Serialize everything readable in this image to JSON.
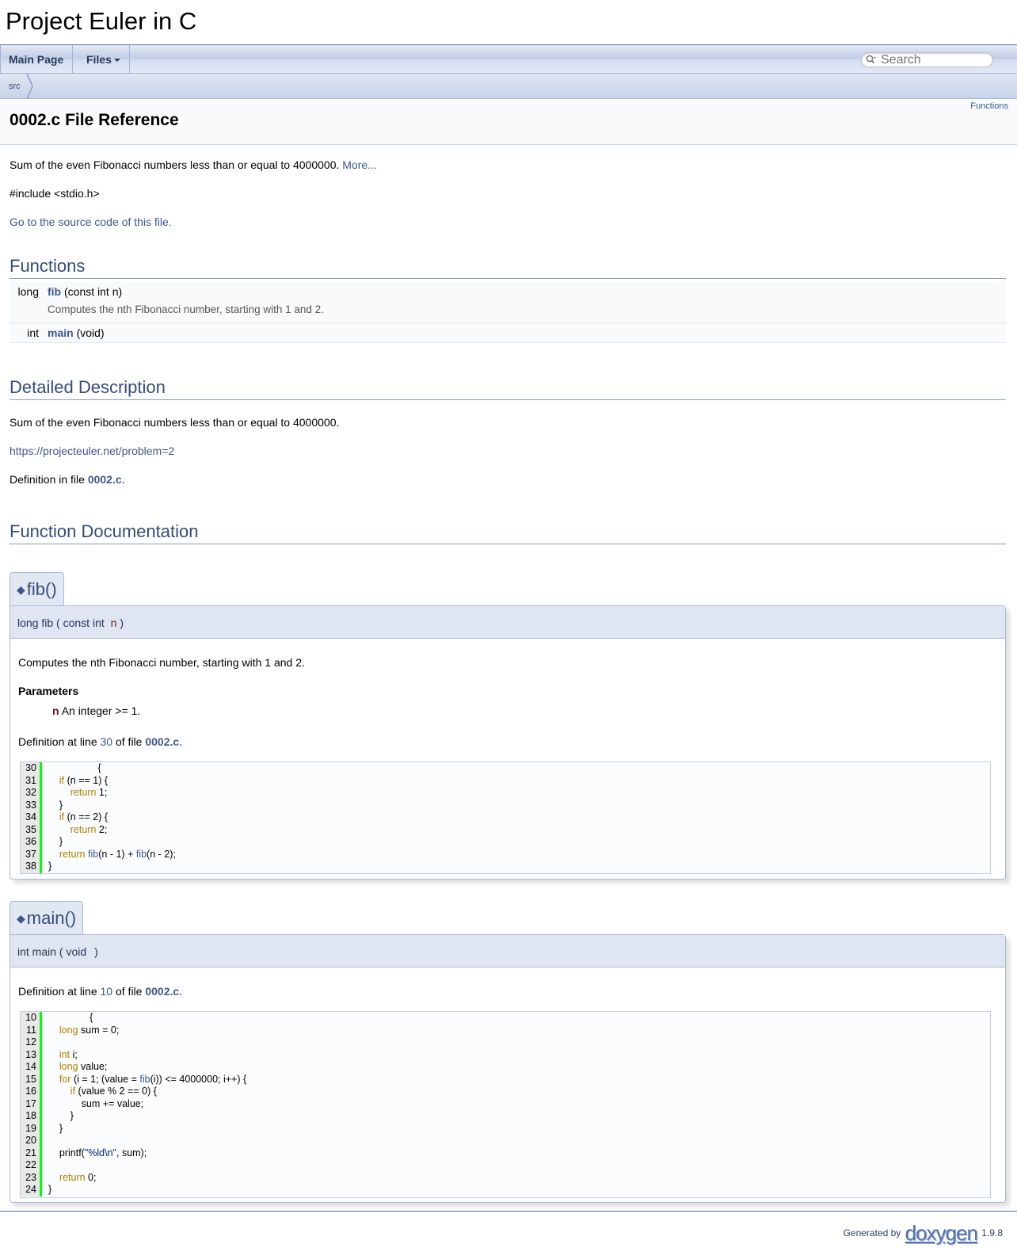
{
  "project_name": "Project Euler in C",
  "nav": {
    "main_page": "Main Page",
    "files": "Files",
    "search_placeholder": "Search"
  },
  "breadcrumb": {
    "item": "src"
  },
  "header": {
    "summary_link": "Functions",
    "title": "0002.c File Reference"
  },
  "brief": {
    "text": "Sum of the even Fibonacci numbers less than or equal to 4000000.",
    "more": "More..."
  },
  "include": "#include <stdio.h>",
  "source_link": "Go to the source code of this file.",
  "functions_section": {
    "heading": "Functions",
    "rows": [
      {
        "type": "long",
        "name": "fib",
        "args": "(const int n)",
        "descr": "Computes the nth Fibonacci number, starting with 1 and 2."
      },
      {
        "type": "int",
        "name": "main",
        "args": "(void)",
        "descr": ""
      }
    ]
  },
  "detailed": {
    "heading": "Detailed Description",
    "text": "Sum of the even Fibonacci numbers less than or equal to 4000000.",
    "url": "https://projecteuler.net/problem=2",
    "def_prefix": "Definition in file ",
    "def_file": "0002.c",
    "def_suffix": "."
  },
  "func_doc": {
    "heading": "Function Documentation",
    "fib": {
      "title": "fib()",
      "proto_type": "long fib",
      "proto_open": "(",
      "proto_arg": "const int",
      "proto_param": "n",
      "proto_close": ")",
      "descr": "Computes the nth Fibonacci number, starting with 1 and 2.",
      "params_heading": "Parameters",
      "param_name": "n",
      "param_desc": "An integer >= 1.",
      "def_prefix": "Definition at line ",
      "def_line": "30",
      "def_mid": " of file ",
      "def_file": "0002.c",
      "def_suffix": "."
    },
    "main": {
      "title": "main()",
      "proto_type": "int main",
      "proto_open": "(",
      "proto_arg": "void",
      "proto_close": ")",
      "def_prefix": "Definition at line ",
      "def_line": "10",
      "def_mid": " of file ",
      "def_file": "0002.c",
      "def_suffix": "."
    }
  },
  "fib_code": [
    {
      "n": "30",
      "tokens": [
        [
          "",
          "                  {"
        ]
      ]
    },
    {
      "n": "31",
      "tokens": [
        [
          "",
          "    "
        ],
        [
          "kw",
          "if"
        ],
        [
          "",
          " (n == 1) {"
        ]
      ]
    },
    {
      "n": "32",
      "tokens": [
        [
          "",
          "        "
        ],
        [
          "kw",
          "return"
        ],
        [
          "",
          " 1;"
        ]
      ]
    },
    {
      "n": "33",
      "tokens": [
        [
          "",
          "    }"
        ]
      ]
    },
    {
      "n": "34",
      "tokens": [
        [
          "",
          "    "
        ],
        [
          "kw",
          "if"
        ],
        [
          "",
          " (n == 2) {"
        ]
      ]
    },
    {
      "n": "35",
      "tokens": [
        [
          "",
          "        "
        ],
        [
          "kw",
          "return"
        ],
        [
          "",
          " 2;"
        ]
      ]
    },
    {
      "n": "36",
      "tokens": [
        [
          "",
          "    }"
        ]
      ]
    },
    {
      "n": "37",
      "tokens": [
        [
          "",
          "    "
        ],
        [
          "kw",
          "return"
        ],
        [
          "",
          " "
        ],
        [
          "fn",
          "fib"
        ],
        [
          "",
          "(n - 1) + "
        ],
        [
          "fn",
          "fib"
        ],
        [
          "",
          "(n - 2);"
        ]
      ]
    },
    {
      "n": "38",
      "tokens": [
        [
          "",
          "}"
        ]
      ]
    }
  ],
  "main_code": [
    {
      "n": "10",
      "tokens": [
        [
          "",
          "               {"
        ]
      ]
    },
    {
      "n": "11",
      "tokens": [
        [
          "",
          "    "
        ],
        [
          "kwt",
          "long"
        ],
        [
          "",
          " sum = 0;"
        ]
      ]
    },
    {
      "n": "12",
      "tokens": [
        [
          "",
          ""
        ]
      ]
    },
    {
      "n": "13",
      "tokens": [
        [
          "",
          "    "
        ],
        [
          "kwt",
          "int"
        ],
        [
          "",
          " i;"
        ]
      ]
    },
    {
      "n": "14",
      "tokens": [
        [
          "",
          "    "
        ],
        [
          "kwt",
          "long"
        ],
        [
          "",
          " value;"
        ]
      ]
    },
    {
      "n": "15",
      "tokens": [
        [
          "",
          "    "
        ],
        [
          "kw",
          "for"
        ],
        [
          "",
          " (i = 1; (value = "
        ],
        [
          "fn",
          "fib"
        ],
        [
          "",
          "(i)) <= 4000000; i++) {"
        ]
      ]
    },
    {
      "n": "16",
      "tokens": [
        [
          "",
          "        "
        ],
        [
          "kw",
          "if"
        ],
        [
          "",
          " (value % 2 == 0) {"
        ]
      ]
    },
    {
      "n": "17",
      "tokens": [
        [
          "",
          "            sum += value;"
        ]
      ]
    },
    {
      "n": "18",
      "tokens": [
        [
          "",
          "        }"
        ]
      ]
    },
    {
      "n": "19",
      "tokens": [
        [
          "",
          "    }"
        ]
      ]
    },
    {
      "n": "20",
      "tokens": [
        [
          "",
          ""
        ]
      ]
    },
    {
      "n": "21",
      "tokens": [
        [
          "",
          "    printf("
        ],
        [
          "str",
          "\"%ld\\n\""
        ],
        [
          "",
          ", sum);"
        ]
      ]
    },
    {
      "n": "22",
      "tokens": [
        [
          "",
          ""
        ]
      ]
    },
    {
      "n": "23",
      "tokens": [
        [
          "",
          "    "
        ],
        [
          "kw",
          "return"
        ],
        [
          "",
          " 0;"
        ]
      ]
    },
    {
      "n": "24",
      "tokens": [
        [
          "",
          "}"
        ]
      ]
    }
  ],
  "footer": {
    "generated_by": "Generated by",
    "logo_text": "doxygen",
    "version": "1.9.8"
  },
  "colors": {
    "link": "#3d578c",
    "heading": "#354c7b",
    "keyword": "#b08000",
    "line_marker": "#00ff00"
  }
}
